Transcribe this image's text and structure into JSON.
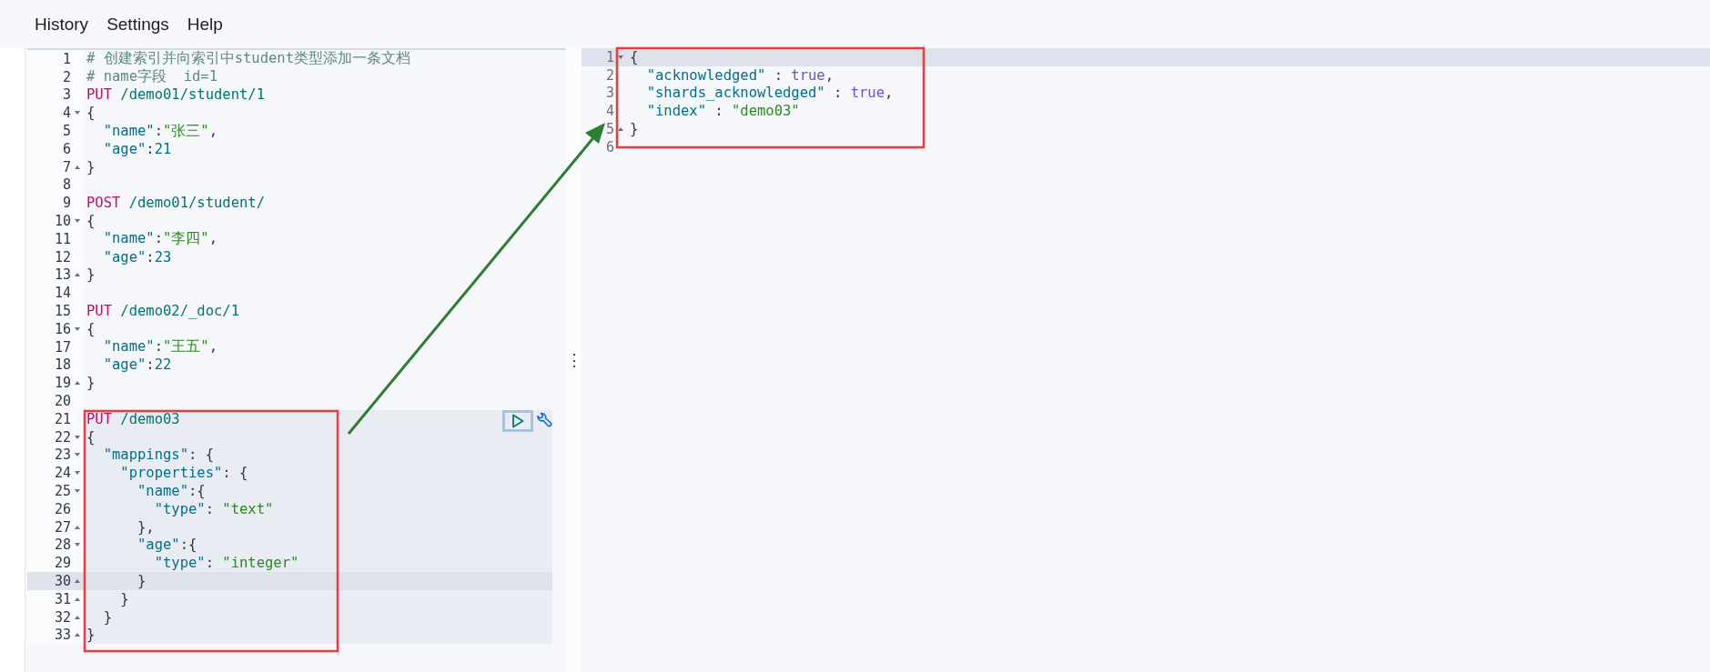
{
  "menu": [
    {
      "label": "History"
    },
    {
      "label": "Settings"
    },
    {
      "label": "Help"
    }
  ],
  "request_editor": {
    "lines": [
      {
        "number": "1",
        "tokens": [
          {
            "kind": "comment",
            "text": "# 创建索引并向索引中student类型添加一条文档"
          }
        ]
      },
      {
        "number": "2",
        "tokens": [
          {
            "kind": "comment",
            "text": "# name字段  id=1"
          }
        ]
      },
      {
        "number": "3",
        "tokens": [
          {
            "kind": "method",
            "text": "PUT"
          },
          {
            "kind": "path",
            "text": " /demo01/student/1"
          }
        ]
      },
      {
        "number": "4",
        "fold_start": true,
        "tokens": [
          {
            "kind": "punct",
            "text": "{"
          }
        ]
      },
      {
        "number": "5",
        "tokens": [
          {
            "kind": "key",
            "text": "  \"name\""
          },
          {
            "kind": "punct",
            "text": ":"
          },
          {
            "kind": "string",
            "text": "\"张三\""
          },
          {
            "kind": "punct",
            "text": ","
          }
        ]
      },
      {
        "number": "6",
        "tokens": [
          {
            "kind": "key",
            "text": "  \"age\""
          },
          {
            "kind": "punct",
            "text": ":"
          },
          {
            "kind": "number",
            "text": "21"
          }
        ]
      },
      {
        "number": "7",
        "fold_end": true,
        "tokens": [
          {
            "kind": "punct",
            "text": "}"
          }
        ]
      },
      {
        "number": "8"
      },
      {
        "number": "9",
        "tokens": [
          {
            "kind": "method",
            "text": "POST"
          },
          {
            "kind": "path",
            "text": " /demo01/student/"
          }
        ]
      },
      {
        "number": "10",
        "fold_start": true,
        "tokens": [
          {
            "kind": "punct",
            "text": "{"
          }
        ]
      },
      {
        "number": "11",
        "tokens": [
          {
            "kind": "key",
            "text": "  \"name\""
          },
          {
            "kind": "punct",
            "text": ":"
          },
          {
            "kind": "string",
            "text": "\"李四\""
          },
          {
            "kind": "punct",
            "text": ","
          }
        ]
      },
      {
        "number": "12",
        "tokens": [
          {
            "kind": "key",
            "text": "  \"age\""
          },
          {
            "kind": "punct",
            "text": ":"
          },
          {
            "kind": "number",
            "text": "23"
          }
        ]
      },
      {
        "number": "13",
        "fold_end": true,
        "tokens": [
          {
            "kind": "punct",
            "text": "}"
          }
        ]
      },
      {
        "number": "14"
      },
      {
        "number": "15",
        "tokens": [
          {
            "kind": "method",
            "text": "PUT"
          },
          {
            "kind": "path",
            "text": " /demo02/_doc/1"
          }
        ]
      },
      {
        "number": "16",
        "fold_start": true,
        "tokens": [
          {
            "kind": "punct",
            "text": "{"
          }
        ]
      },
      {
        "number": "17",
        "tokens": [
          {
            "kind": "key",
            "text": "  \"name\""
          },
          {
            "kind": "punct",
            "text": ":"
          },
          {
            "kind": "string",
            "text": "\"王五\""
          },
          {
            "kind": "punct",
            "text": ","
          }
        ]
      },
      {
        "number": "18",
        "tokens": [
          {
            "kind": "key",
            "text": "  \"age\""
          },
          {
            "kind": "punct",
            "text": ":"
          },
          {
            "kind": "number",
            "text": "22"
          }
        ]
      },
      {
        "number": "19",
        "fold_end": true,
        "tokens": [
          {
            "kind": "punct",
            "text": "}"
          }
        ]
      },
      {
        "number": "20"
      },
      {
        "number": "21",
        "in_request": true,
        "tokens": [
          {
            "kind": "method",
            "text": "PUT"
          },
          {
            "kind": "path",
            "text": " /demo03"
          }
        ]
      },
      {
        "number": "22",
        "in_request": true,
        "fold_start": true,
        "tokens": [
          {
            "kind": "punct",
            "text": "{"
          }
        ]
      },
      {
        "number": "23",
        "in_request": true,
        "fold_start": true,
        "tokens": [
          {
            "kind": "key",
            "text": "  \"mappings\""
          },
          {
            "kind": "punct",
            "text": ": {"
          }
        ]
      },
      {
        "number": "24",
        "in_request": true,
        "fold_start": true,
        "tokens": [
          {
            "kind": "key",
            "text": "    \"properties\""
          },
          {
            "kind": "punct",
            "text": ": {"
          }
        ]
      },
      {
        "number": "25",
        "in_request": true,
        "fold_start": true,
        "tokens": [
          {
            "kind": "key",
            "text": "      \"name\""
          },
          {
            "kind": "punct",
            "text": ":{"
          }
        ]
      },
      {
        "number": "26",
        "in_request": true,
        "tokens": [
          {
            "kind": "key",
            "text": "        \"type\""
          },
          {
            "kind": "punct",
            "text": ": "
          },
          {
            "kind": "string",
            "text": "\"text\""
          }
        ]
      },
      {
        "number": "27",
        "in_request": true,
        "fold_end": true,
        "tokens": [
          {
            "kind": "punct",
            "text": "      },"
          }
        ]
      },
      {
        "number": "28",
        "in_request": true,
        "fold_start": true,
        "tokens": [
          {
            "kind": "key",
            "text": "      \"age\""
          },
          {
            "kind": "punct",
            "text": ":{"
          }
        ]
      },
      {
        "number": "29",
        "in_request": true,
        "tokens": [
          {
            "kind": "key",
            "text": "        \"type\""
          },
          {
            "kind": "punct",
            "text": ": "
          },
          {
            "kind": "string",
            "text": "\"integer\""
          }
        ]
      },
      {
        "number": "30",
        "in_request": true,
        "active": true,
        "fold_end": true,
        "tokens": [
          {
            "kind": "punct",
            "text": "      }"
          }
        ]
      },
      {
        "number": "31",
        "in_request": true,
        "fold_end": true,
        "tokens": [
          {
            "kind": "punct",
            "text": "    }"
          }
        ]
      },
      {
        "number": "32",
        "in_request": true,
        "fold_end": true,
        "tokens": [
          {
            "kind": "punct",
            "text": "  }"
          }
        ]
      },
      {
        "number": "33",
        "in_request": true,
        "fold_end": true,
        "tokens": [
          {
            "kind": "punct",
            "text": "}"
          }
        ]
      }
    ]
  },
  "resizer": {
    "glyph": "⋮"
  },
  "response_viewer": {
    "lines": [
      {
        "number": "1",
        "active": true,
        "fold_start": true,
        "tokens": [
          {
            "kind": "punct",
            "text": "{"
          }
        ]
      },
      {
        "number": "2",
        "tokens": [
          {
            "kind": "key",
            "text": "  \"acknowledged\""
          },
          {
            "kind": "punct",
            "text": " : "
          },
          {
            "kind": "bool",
            "text": "true"
          },
          {
            "kind": "punct",
            "text": ","
          }
        ]
      },
      {
        "number": "3",
        "tokens": [
          {
            "kind": "key",
            "text": "  \"shards_acknowledged\""
          },
          {
            "kind": "punct",
            "text": " : "
          },
          {
            "kind": "bool",
            "text": "true"
          },
          {
            "kind": "punct",
            "text": ","
          }
        ]
      },
      {
        "number": "4",
        "tokens": [
          {
            "kind": "key",
            "text": "  \"index\""
          },
          {
            "kind": "punct",
            "text": " : "
          },
          {
            "kind": "string",
            "text": "\"demo03\""
          }
        ]
      },
      {
        "number": "5",
        "fold_end": true,
        "tokens": [
          {
            "kind": "punct",
            "text": "}"
          }
        ]
      },
      {
        "number": "6"
      }
    ]
  }
}
